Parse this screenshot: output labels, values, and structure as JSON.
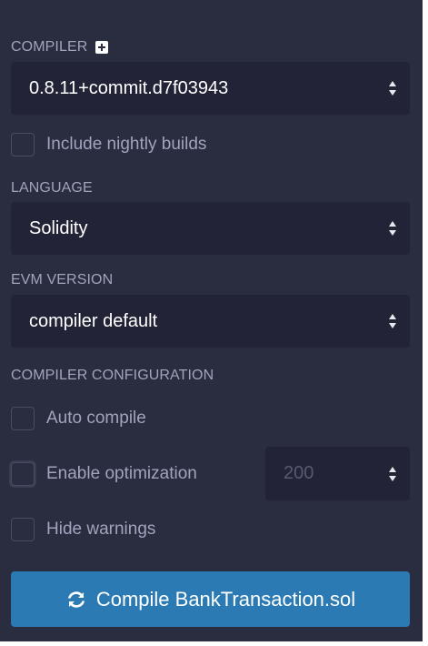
{
  "compiler": {
    "label": "COMPILER",
    "selected_version": "0.8.11+commit.d7f03943",
    "include_nightly_label": "Include nightly builds",
    "include_nightly_checked": false
  },
  "language": {
    "label": "LANGUAGE",
    "selected": "Solidity"
  },
  "evm_version": {
    "label": "EVM VERSION",
    "selected": "compiler default"
  },
  "configuration": {
    "label": "COMPILER CONFIGURATION",
    "auto_compile_label": "Auto compile",
    "auto_compile_checked": false,
    "optimization_label": "Enable optimization",
    "optimization_checked": false,
    "runs_value": "200",
    "hide_warnings_label": "Hide warnings",
    "hide_warnings_checked": false
  },
  "compile_button": {
    "label": "Compile BankTransaction.sol",
    "icon": "refresh-icon"
  },
  "colors": {
    "panel_bg": "#2a2c3f",
    "field_bg": "#222336",
    "text_muted": "#a2a3bd",
    "button_bg": "#2b7ab3"
  }
}
